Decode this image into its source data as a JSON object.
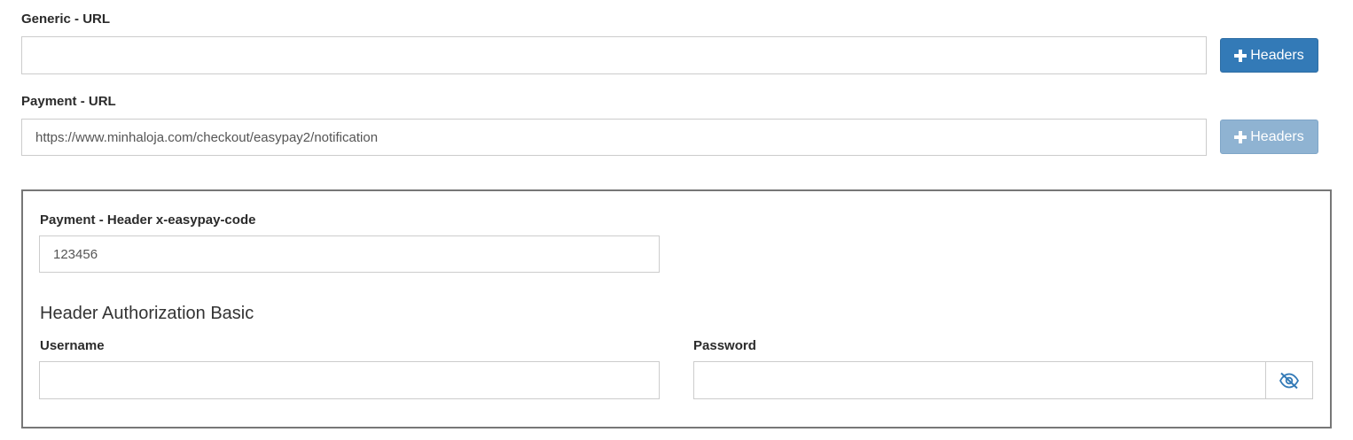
{
  "generic": {
    "label": "Generic - URL",
    "value": "",
    "headers_button": "Headers"
  },
  "payment": {
    "label": "Payment - URL",
    "value": "https://www.minhaloja.com/checkout/easypay2/notification",
    "headers_button": "Headers"
  },
  "headers_panel": {
    "code_label": "Payment - Header x-easypay-code",
    "code_value": "123456",
    "auth_title": "Header Authorization Basic",
    "username_label": "Username",
    "username_value": "",
    "password_label": "Password",
    "password_value": ""
  },
  "icons": {
    "headers_button_icon": "plus-icon",
    "password_toggle_icon": "eye-slash-icon"
  },
  "colors": {
    "primary_button": "#337ab7",
    "disabled_button": "#8fb3d2",
    "eye_icon": "#337ab7"
  }
}
